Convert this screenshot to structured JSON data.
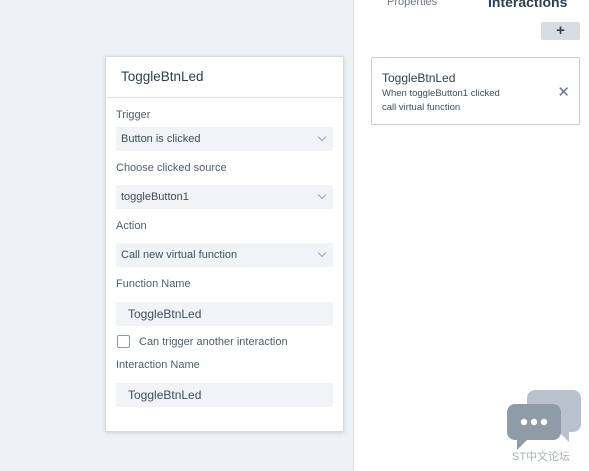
{
  "editor": {
    "title": "ToggleBtnLed",
    "trigger_label": "Trigger",
    "trigger_value": "Button is clicked",
    "source_label": "Choose clicked source",
    "source_value": "toggleButton1",
    "action_label": "Action",
    "action_value": "Call new virtual function",
    "function_name_label": "Function Name",
    "function_name_value": "ToggleBtnLed",
    "checkbox_label": "Can trigger another interaction",
    "interaction_name_label": "Interaction Name",
    "interaction_name_value": "ToggleBtnLed"
  },
  "panel": {
    "tab_properties": "Properties",
    "tab_interactions": "Interactions",
    "add_label": "+",
    "interaction": {
      "title": "ToggleBtnLed",
      "desc_line1": "When toggleButton1 clicked",
      "desc_line2": "call virtual function",
      "close": "✕"
    }
  },
  "watermark": {
    "text": "ST中文论坛"
  }
}
